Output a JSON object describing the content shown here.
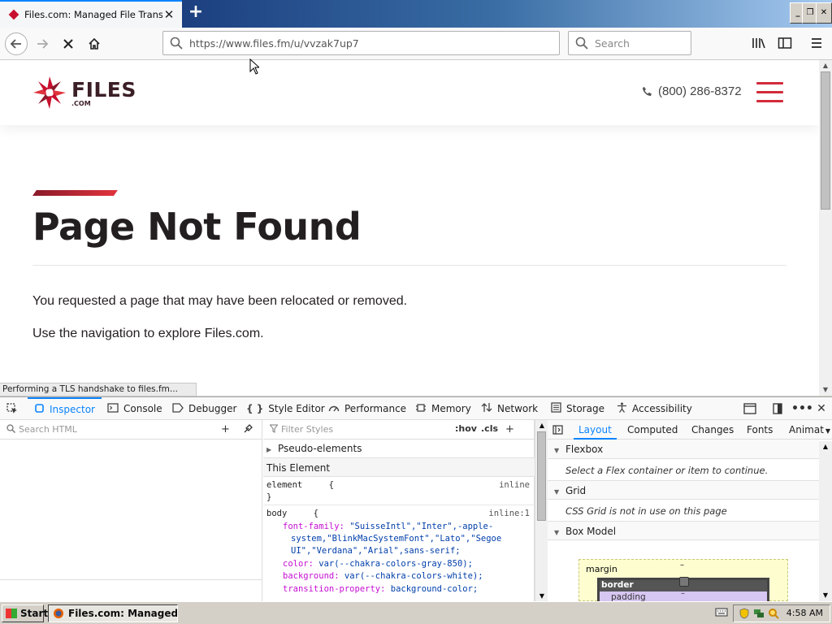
{
  "browser": {
    "tab": {
      "title": "Files.com: Managed File Transfer",
      "close": "✕"
    },
    "new_tab": "+",
    "window_controls": {
      "minimize": "_",
      "restore": "❐",
      "close": "✕"
    },
    "url": "https://www.files.fm/u/vvzak7up7",
    "search_placeholder": "Search",
    "status_text": "Performing a TLS handshake to files.fm..."
  },
  "site": {
    "logo_word": "FILES",
    "logo_sub": ".COM",
    "phone": "(800) 286-8372",
    "heading": "Page Not Found",
    "paragraphs": [
      "You requested a page that may have been relocated or removed.",
      "Use the navigation to explore Files.com."
    ],
    "brand_color": "#d22b3a"
  },
  "devtools": {
    "tabs": [
      "Inspector",
      "Console",
      "Debugger",
      "Style Editor",
      "Performance",
      "Memory",
      "Network",
      "Storage",
      "Accessibility"
    ],
    "active_tab": "Inspector",
    "html_search_placeholder": "Search HTML",
    "styles_filter_placeholder": "Filter Styles",
    "hov": ":hov",
    "cls": ".cls",
    "pseudo_elements": "Pseudo-elements",
    "this_element": "This Element",
    "element_rule": {
      "selector": "element",
      "brace_open": "{",
      "source": "inline",
      "brace_close": "}"
    },
    "body_rule": {
      "selector": "body",
      "brace_open": "{",
      "source": "inline:1",
      "decls": [
        {
          "prop": "font-family:",
          "value": "\"SuisseIntl\",\"Inter\",-apple-"
        },
        {
          "prop": "",
          "value": "system,\"BlinkMacSystemFont\",\"Lato\",\"Segoe"
        },
        {
          "prop": "",
          "value": "UI\",\"Verdana\",\"Arial\",sans-serif;"
        },
        {
          "prop": "color:",
          "value": "var(--chakra-colors-gray-850);"
        },
        {
          "prop": "background:",
          "value": "var(--chakra-colors-white);"
        },
        {
          "prop": "transition-property:",
          "value": "background-color;"
        }
      ]
    },
    "layout_tabs": [
      "Layout",
      "Computed",
      "Changes",
      "Fonts",
      "Animat"
    ],
    "sections": {
      "flexbox": "Flexbox",
      "flexbox_note": "Select a Flex container or item to continue.",
      "grid": "Grid",
      "grid_note": "CSS Grid is not in use on this page",
      "box_model": "Box Model",
      "margin": "margin",
      "border": "border",
      "padding": "padding",
      "dash": "–"
    }
  },
  "taskbar": {
    "start": "Start",
    "task": "Files.com: Managed Fi...",
    "clock": "4:58 AM"
  }
}
